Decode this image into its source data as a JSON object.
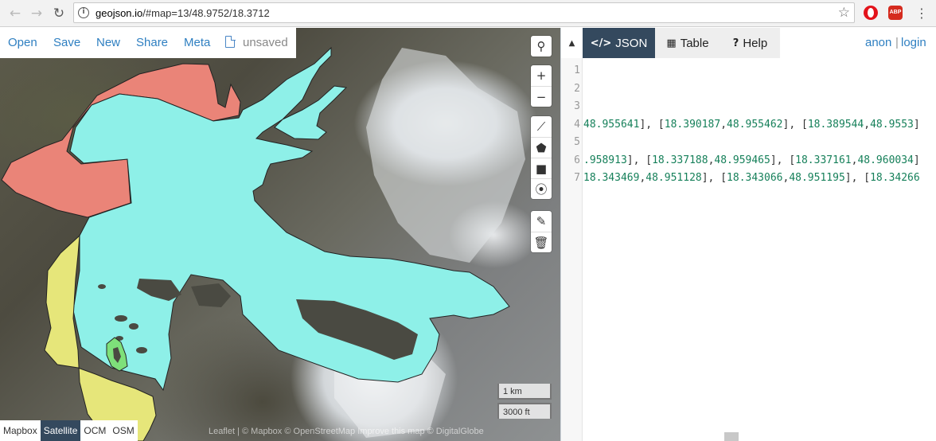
{
  "browser": {
    "url_host": "geojson.io",
    "url_path": "/#map=13/48.9752/18.3712",
    "back_icon": "←",
    "forward_icon": "→",
    "reload_icon": "↻",
    "star_icon": "☆",
    "menu_icon": "⋮",
    "abp_label": "ABP",
    "info_glyph": "i"
  },
  "menu": {
    "open": "Open",
    "save": "Save",
    "new": "New",
    "share": "Share",
    "meta": "Meta",
    "unsaved": "unsaved"
  },
  "map_controls": {
    "search_icon": "⚲",
    "zoom_in": "+",
    "zoom_out": "−",
    "draw_line_icon": "⟋",
    "draw_polygon_icon": "⬟",
    "draw_rectangle_icon": "■",
    "draw_marker_icon": "⦿",
    "edit_icon": "✎",
    "delete_icon": "🗑"
  },
  "scale": {
    "km": "1 km",
    "ft": "3000 ft"
  },
  "layers": [
    "Mapbox",
    "Satellite",
    "OCM",
    "OSM"
  ],
  "active_layer": "Satellite",
  "attribution": "Leaflet | © Mapbox © OpenStreetMap Improve this map © DigitalGlobe",
  "tabs": {
    "collapse_icon": "▲",
    "json": "JSON",
    "json_icon": "</>",
    "table": "Table",
    "table_icon": "▦",
    "help": "Help",
    "help_icon": "?"
  },
  "auth": {
    "anon": "anon",
    "sep": "|",
    "login": "login"
  },
  "editor": {
    "line_numbers": [
      "1",
      "2",
      "3",
      "4",
      "5",
      "6",
      "7"
    ],
    "lines": [
      "",
      "",
      "",
      "48.955641], [18.390187,48.955462], [18.389544,48.9553]",
      "",
      ".958913], [18.337188,48.959465], [18.337161,48.960034]",
      "18.343469,48.951128], [18.343066,48.951195], [18.34266"
    ]
  },
  "colors": {
    "link": "#2e7fc1",
    "tab_active": "#34495e",
    "poly_cyan": "#8ef0e8",
    "poly_red": "#ea8478",
    "poly_yellow": "#e6e67a",
    "poly_green": "#7ee07a",
    "number": "#16805a"
  }
}
